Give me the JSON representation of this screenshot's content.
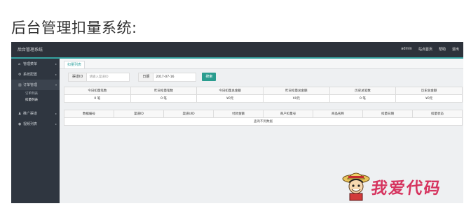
{
  "page_heading": "后台管理扣量系统:",
  "header": {
    "brand": "后台管理系统",
    "nav": [
      "admin",
      "站点首页",
      "帮助",
      "退出"
    ]
  },
  "sidebar": {
    "items": [
      {
        "label": "管理菜单",
        "icon": "home-icon"
      },
      {
        "label": "系统配置",
        "icon": "gear-icon"
      },
      {
        "label": "订单管理",
        "icon": "chart-icon"
      },
      {
        "label": "推广渠道",
        "icon": "user-icon"
      },
      {
        "label": "视频列表",
        "icon": "video-icon"
      }
    ],
    "subitems": [
      "订单列表",
      "扣量列表"
    ]
  },
  "tabs": {
    "current": "扣量列表"
  },
  "filters": {
    "channel_label": "渠道ID",
    "channel_placeholder": "请输入渠道ID",
    "date_label": "日期",
    "date_value": "2017-07-16",
    "search_label": "搜索"
  },
  "stats": {
    "headers": [
      "今日扣量笔数",
      "昨日扣量笔数",
      "今日扣量总金额",
      "昨日扣量总金额",
      "历史总笔数",
      "历史总金额"
    ],
    "values": [
      "0 笔",
      "0 笔",
      "¥0元",
      "¥0元",
      "0 笔",
      "¥0元"
    ]
  },
  "orders": {
    "headers": [
      "数据编号",
      "渠道ID",
      "渠道UID",
      "付款金额",
      "商户扣量号",
      "商品名称",
      "扣量日期",
      "扣量状态"
    ],
    "empty_text": "查询不到数据"
  },
  "watermark": {
    "text": "我爱代码"
  },
  "colors": {
    "accent": "#35a3a1",
    "topbar": "#2d323b",
    "sidebar": "#2f3640",
    "search_button": "#2a9d8f",
    "watermark": "#d6345f"
  }
}
